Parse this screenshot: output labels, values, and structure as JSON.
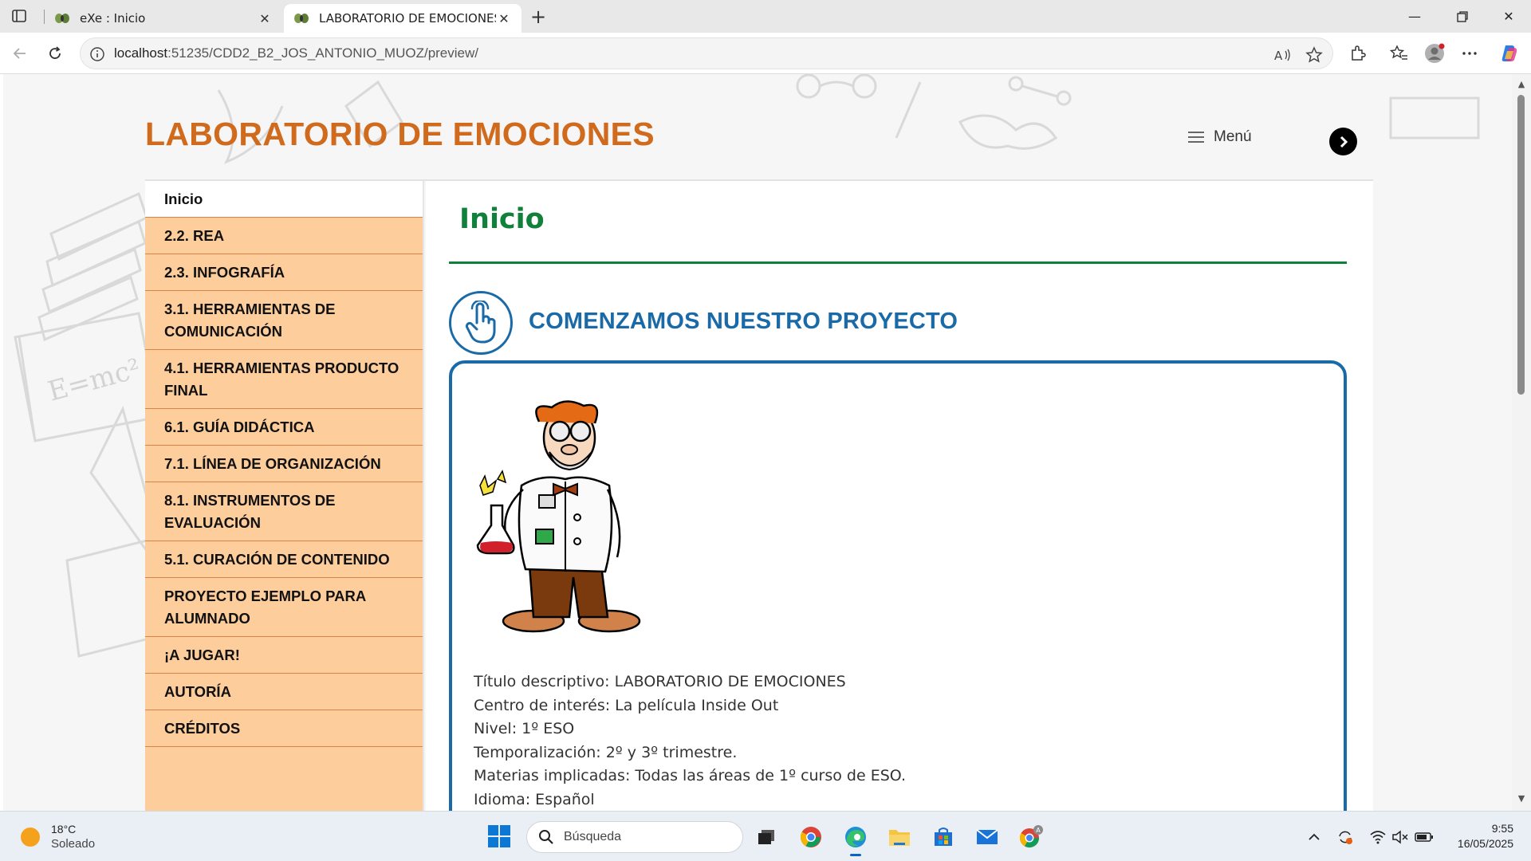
{
  "browser": {
    "tabs": [
      {
        "title": "eXe : Inicio",
        "active": false
      },
      {
        "title": "LABORATORIO DE EMOCIONES",
        "active": true
      }
    ],
    "url_host": "localhost",
    "url_rest": ":51235/CDD2_B2_JOS_ANTONIO_MUOZ/preview/"
  },
  "site": {
    "title": "LABORATORIO DE EMOCIONES",
    "menu_label": "Menú"
  },
  "nav": {
    "items": [
      {
        "label": "Inicio",
        "active": true
      },
      {
        "label": "2.2. REA"
      },
      {
        "label": "2.3. INFOGRAFÍA"
      },
      {
        "label": "3.1. HERRAMIENTAS DE COMUNICACIÓN"
      },
      {
        "label": "4.1. HERRAMIENTAS PRODUCTO FINAL"
      },
      {
        "label": "6.1. GUÍA DIDÁCTICA"
      },
      {
        "label": "7.1. LÍNEA DE ORGANIZACIÓN"
      },
      {
        "label": "8.1. INSTRUMENTOS DE EVALUACIÓN"
      },
      {
        "label": "5.1. CURACIÓN DE CONTENIDO"
      },
      {
        "label": "PROYECTO EJEMPLO PARA ALUMNADO"
      },
      {
        "label": "¡A JUGAR!"
      },
      {
        "label": "AUTORÍA"
      },
      {
        "label": "CRÉDITOS"
      }
    ]
  },
  "content": {
    "page_title": "Inicio",
    "idevice_title": "COMENZAMOS NUESTRO PROYECTO",
    "info_lines": [
      "Título descriptivo: LABORATORIO DE EMOCIONES",
      "Centro de interés: La película Inside Out",
      "Nivel: 1º ESO",
      "Temporalización: 2º y 3º trimestre.",
      "Materias implicadas: Todas las áreas de 1º curso de ESO.",
      "Idioma: Español"
    ]
  },
  "taskbar": {
    "temperature": "18°C",
    "weather": "Soleado",
    "search_placeholder": "Búsqueda",
    "time": "9:55",
    "date": "16/05/2025"
  },
  "colors": {
    "title_orange": "#d06a1c",
    "nav_bg": "#fdcd9c",
    "nav_border": "#d7834a",
    "heading_green": "#10803a",
    "idevice_blue": "#1b6aa8"
  }
}
